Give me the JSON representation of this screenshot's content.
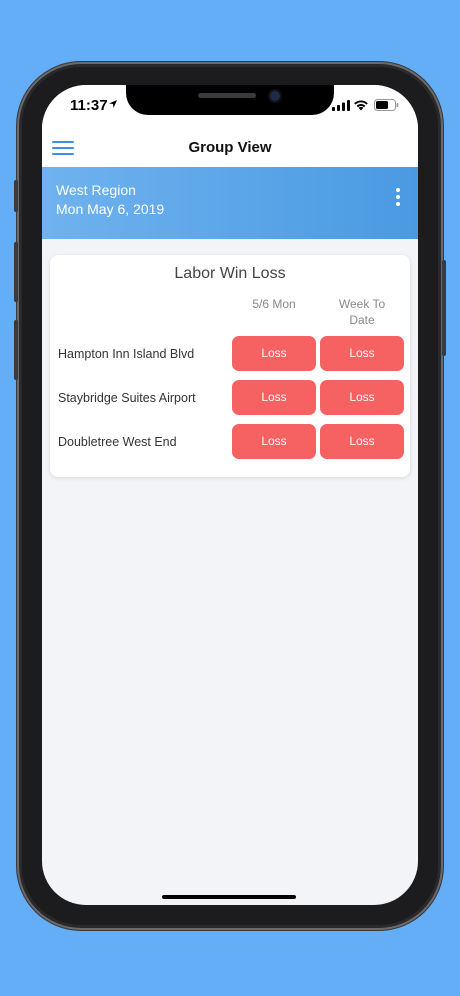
{
  "status_bar": {
    "time": "11:37"
  },
  "nav": {
    "title": "Group View"
  },
  "region": {
    "name": "West Region",
    "date": "Mon May 6, 2019"
  },
  "card": {
    "title": "Labor Win Loss",
    "columns": [
      "5/6 Mon",
      "Week To Date"
    ],
    "rows": [
      {
        "hotel": "Hampton Inn Island Blvd",
        "day": "Loss",
        "week": "Loss"
      },
      {
        "hotel": "Staybridge Suites Airport",
        "day": "Loss",
        "week": "Loss"
      },
      {
        "hotel": "Doubletree West End",
        "day": "Loss",
        "week": "Loss"
      }
    ]
  },
  "colors": {
    "accent": "#3b8fe6",
    "loss": "#f66161",
    "background": "#64aef8"
  },
  "icons": [
    "location-arrow-icon",
    "signal-icon",
    "wifi-icon",
    "battery-icon",
    "menu-icon",
    "more-vertical-icon"
  ]
}
